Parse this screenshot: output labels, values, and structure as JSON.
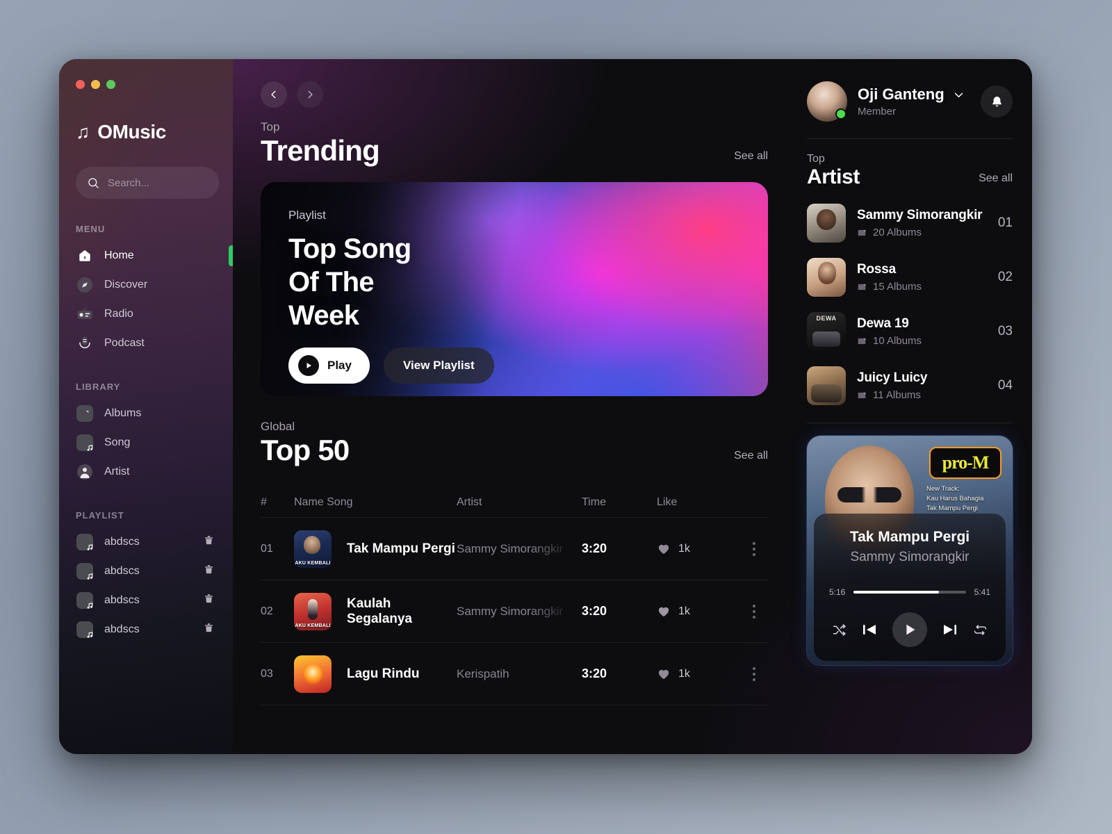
{
  "window": {
    "controls": [
      "close",
      "minimize",
      "maximize"
    ]
  },
  "sidebar": {
    "brand": {
      "mark": "♫",
      "name": "OMusic"
    },
    "search": {
      "placeholder": "Search...",
      "value": ""
    },
    "menu_label": "MENU",
    "menu_items": [
      {
        "label": "Home",
        "icon": "home-icon",
        "active": true
      },
      {
        "label": "Discover",
        "icon": "compass-icon",
        "active": false
      },
      {
        "label": "Radio",
        "icon": "radio-icon",
        "active": false
      },
      {
        "label": "Podcast",
        "icon": "microphone-icon",
        "active": false
      }
    ],
    "library_label": "LIBRARY",
    "library_items": [
      {
        "label": "Albums",
        "icon": "album-icon"
      },
      {
        "label": "Song",
        "icon": "music-note-icon"
      },
      {
        "label": "Artist",
        "icon": "person-icon"
      }
    ],
    "playlist_label": "PLAYLIST",
    "playlists": [
      {
        "label": "abdscs"
      },
      {
        "label": "abdscs"
      },
      {
        "label": "abdscs"
      },
      {
        "label": "abdscs"
      }
    ]
  },
  "main": {
    "nav": {
      "back": "back-arrow",
      "forward": "forward-arrow"
    },
    "trending": {
      "eyebrow": "Top",
      "title": "Trending",
      "see_all": "See all"
    },
    "hero": {
      "eyebrow": "Playlist",
      "title_lines": [
        "Top Song",
        "Of The",
        "Week"
      ],
      "play_label": "Play",
      "view_label": "View Playlist"
    },
    "top50": {
      "eyebrow": "Global",
      "title": "Top 50",
      "see_all": "See all",
      "columns": [
        "#",
        "Name Song",
        "Artist",
        "Time",
        "Like"
      ],
      "rows": [
        {
          "num": "01",
          "song": "Tak Mampu Pergi",
          "artist": "Sammy Simorangkir",
          "time": "3:20",
          "likes": "1k",
          "art": "art1",
          "art_caption": "AKU KEMBALI"
        },
        {
          "num": "02",
          "song": "Kaulah Segalanya",
          "artist": "Sammy Simorangkir",
          "time": "3:20",
          "likes": "1k",
          "art": "art2",
          "art_caption": "AKU KEMBALI"
        },
        {
          "num": "03",
          "song": "Lagu Rindu",
          "artist": "Kerispatih",
          "time": "3:20",
          "likes": "1k",
          "art": "art3",
          "art_caption": ""
        }
      ]
    }
  },
  "right": {
    "profile": {
      "name": "Oji Ganteng",
      "role": "Member",
      "status": "online"
    },
    "top_artist": {
      "eyebrow": "Top",
      "title": "Artist",
      "see_all": "See all",
      "artists": [
        {
          "name": "Sammy Simorangkir",
          "albums": "20 Albums",
          "rank": "01"
        },
        {
          "name": "Rossa",
          "albums": "15 Albums",
          "rank": "02"
        },
        {
          "name": "Dewa 19",
          "albums": "10 Albums",
          "rank": "03"
        },
        {
          "name": "Juicy Luicy",
          "albums": "11 Albums",
          "rank": "04"
        }
      ]
    },
    "now_playing": {
      "logo_text": "pro-M",
      "promo_line1": "New Track:",
      "promo_line2": "Kau Harus Bahagia",
      "promo_line3": "Tak Mampu Pergi",
      "title": "Tak Mampu Pergi",
      "artist": "Sammy Simorangkir",
      "elapsed": "5:16",
      "duration": "5:41",
      "progress_percent": 76
    }
  },
  "colors": {
    "accent_green": "#2fc967",
    "hero_blue": "#3a55e0",
    "hero_purple": "#9a62f8",
    "hero_magenta": "#ee33ee",
    "hero_pink": "#fb3a78",
    "logo_orange": "#ff9a1f",
    "logo_yellow": "#e8e838"
  }
}
